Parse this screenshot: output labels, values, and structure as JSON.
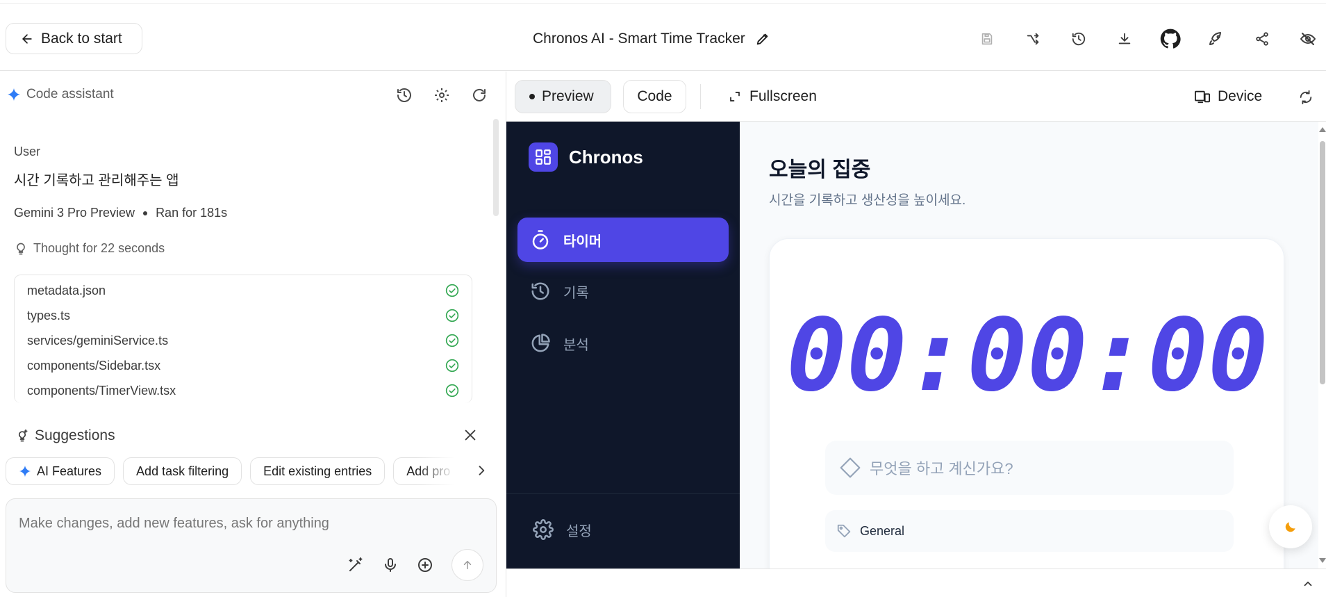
{
  "topbar": {
    "back_label": "Back to start",
    "project_title": "Chronos AI - Smart Time Tracker",
    "icons": [
      "save-icon",
      "fork-icon",
      "history-icon",
      "download-icon",
      "github-icon",
      "rocket-icon",
      "share-icon",
      "hide-icon"
    ]
  },
  "assistant": {
    "title": "Code assistant",
    "user_label": "User",
    "user_message": "시간 기록하고 관리해주는 앱",
    "model": "Gemini 3 Pro Preview",
    "run_time": "Ran for 181s",
    "thought": "Thought for 22 seconds",
    "files": [
      {
        "name": "metadata.json",
        "status": "done"
      },
      {
        "name": "types.ts",
        "status": "done"
      },
      {
        "name": "services/geminiService.ts",
        "status": "done"
      },
      {
        "name": "components/Sidebar.tsx",
        "status": "done"
      },
      {
        "name": "components/TimerView.tsx",
        "status": "done"
      }
    ],
    "suggestions_title": "Suggestions",
    "suggestions": [
      "AI Features",
      "Add task filtering",
      "Edit existing entries",
      "Add pro"
    ],
    "composer_placeholder": "Make changes, add new features, ask for anything"
  },
  "preview": {
    "tabs": {
      "preview": "Preview",
      "code": "Code",
      "fullscreen": "Fullscreen",
      "device": "Device"
    },
    "active_tab": "Preview",
    "app": {
      "brand": "Chronos",
      "nav": [
        {
          "label": "타이머",
          "icon": "timer-icon",
          "active": true
        },
        {
          "label": "기록",
          "icon": "history-icon",
          "active": false
        },
        {
          "label": "분석",
          "icon": "pie-chart-icon",
          "active": false
        }
      ],
      "settings_label": "설정",
      "page_title": "오늘의 집중",
      "page_subtitle": "시간을 기록하고 생산성을 높이세요.",
      "timer": "00:00:00",
      "task_placeholder": "무엇을 하고 계신가요?",
      "category": "General",
      "accent": "#4f46e5",
      "sidebar_bg": "#0f172a"
    }
  }
}
